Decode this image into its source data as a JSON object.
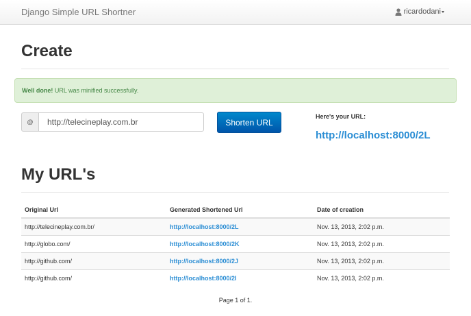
{
  "navbar": {
    "brand": "Django Simple URL Shortner",
    "user": "ricardodani"
  },
  "create": {
    "title": "Create",
    "alert_strong": "Well done!",
    "alert_text": " URL was minified successfully.",
    "addon_symbol": "@",
    "url_value": "http://telecineplay.com.br",
    "button_label": "Shorten URL",
    "result_label": "Here's your URL:",
    "result_url": "http://localhost:8000/2L"
  },
  "urls": {
    "title": "My URL's",
    "columns": [
      "Original Url",
      "Generated Shortened Url",
      "Date of creation"
    ],
    "rows": [
      {
        "original": "http://telecineplay.com.br/",
        "short": "http://localhost:8000/2L",
        "date": "Nov. 13, 2013, 2:02 p.m."
      },
      {
        "original": "http://globo.com/",
        "short": "http://localhost:8000/2K",
        "date": "Nov. 13, 2013, 2:02 p.m."
      },
      {
        "original": "http://github.com/",
        "short": "http://localhost:8000/2J",
        "date": "Nov. 13, 2013, 2:02 p.m."
      },
      {
        "original": "http://github.com/",
        "short": "http://localhost:8000/2I",
        "date": "Nov. 13, 2013, 2:02 p.m."
      }
    ],
    "pagination": "Page 1 of 1."
  },
  "colors": {
    "link": "#2a8dd4",
    "success_bg": "#dff0d8",
    "success_text": "#468847",
    "primary_button": "#0077c2"
  },
  "icons": {
    "user": "user-icon",
    "caret": "caret-down-icon"
  }
}
